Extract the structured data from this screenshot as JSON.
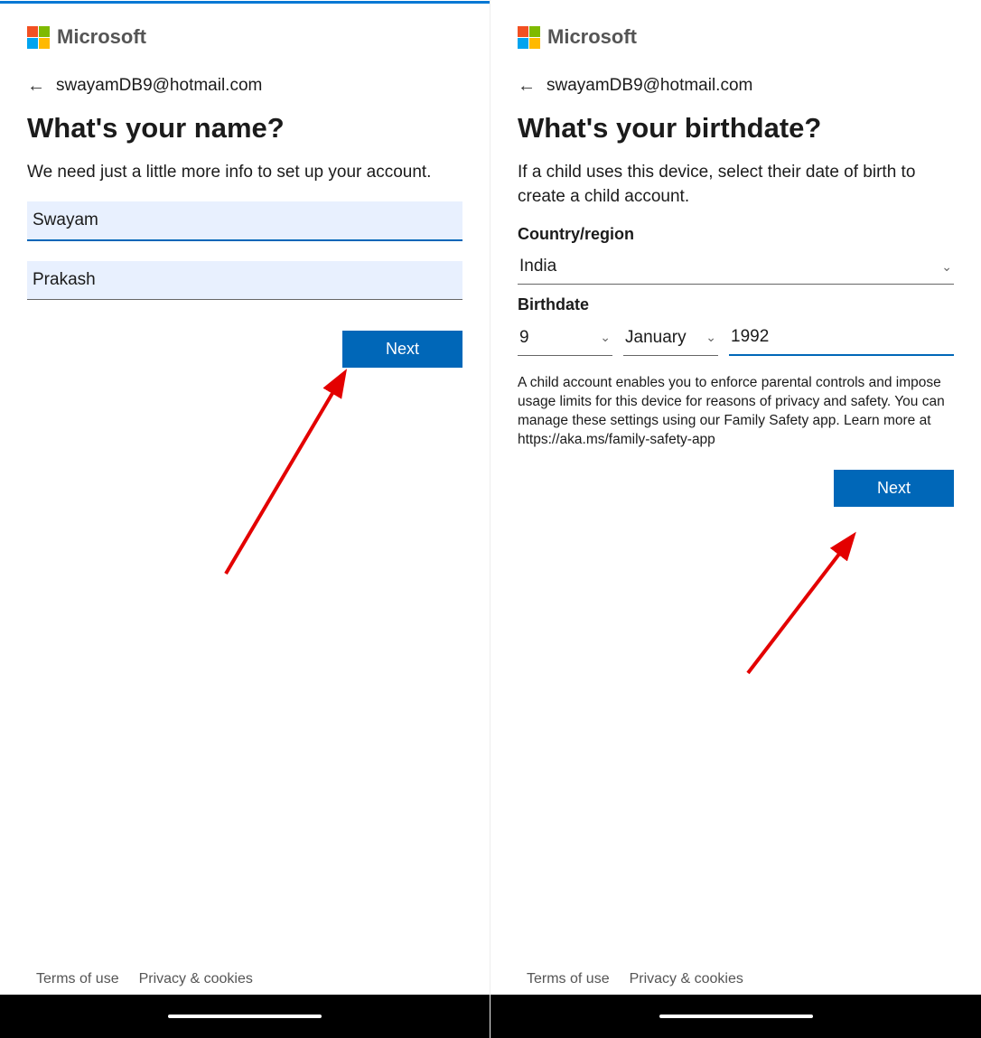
{
  "brand": "Microsoft",
  "left": {
    "email": "swayamDB9@hotmail.com",
    "heading": "What's your name?",
    "subtext": "We need just a little more info to set up your account.",
    "first_name": "Swayam",
    "last_name": "Prakash",
    "next_label": "Next"
  },
  "right": {
    "email": "swayamDB9@hotmail.com",
    "heading": "What's your birthdate?",
    "subtext": "If a child uses this device, select their date of birth to create a child account.",
    "country_label": "Country/region",
    "country_value": "India",
    "birthdate_label": "Birthdate",
    "day": "9",
    "month": "January",
    "year": "1992",
    "info": "A child account enables you to enforce parental controls and impose usage limits for this device for reasons of privacy and safety. You can manage these settings using our Family Safety app. Learn more at https://aka.ms/family-safety-app",
    "next_label": "Next"
  },
  "footer": {
    "terms": "Terms of use",
    "privacy": "Privacy & cookies"
  }
}
